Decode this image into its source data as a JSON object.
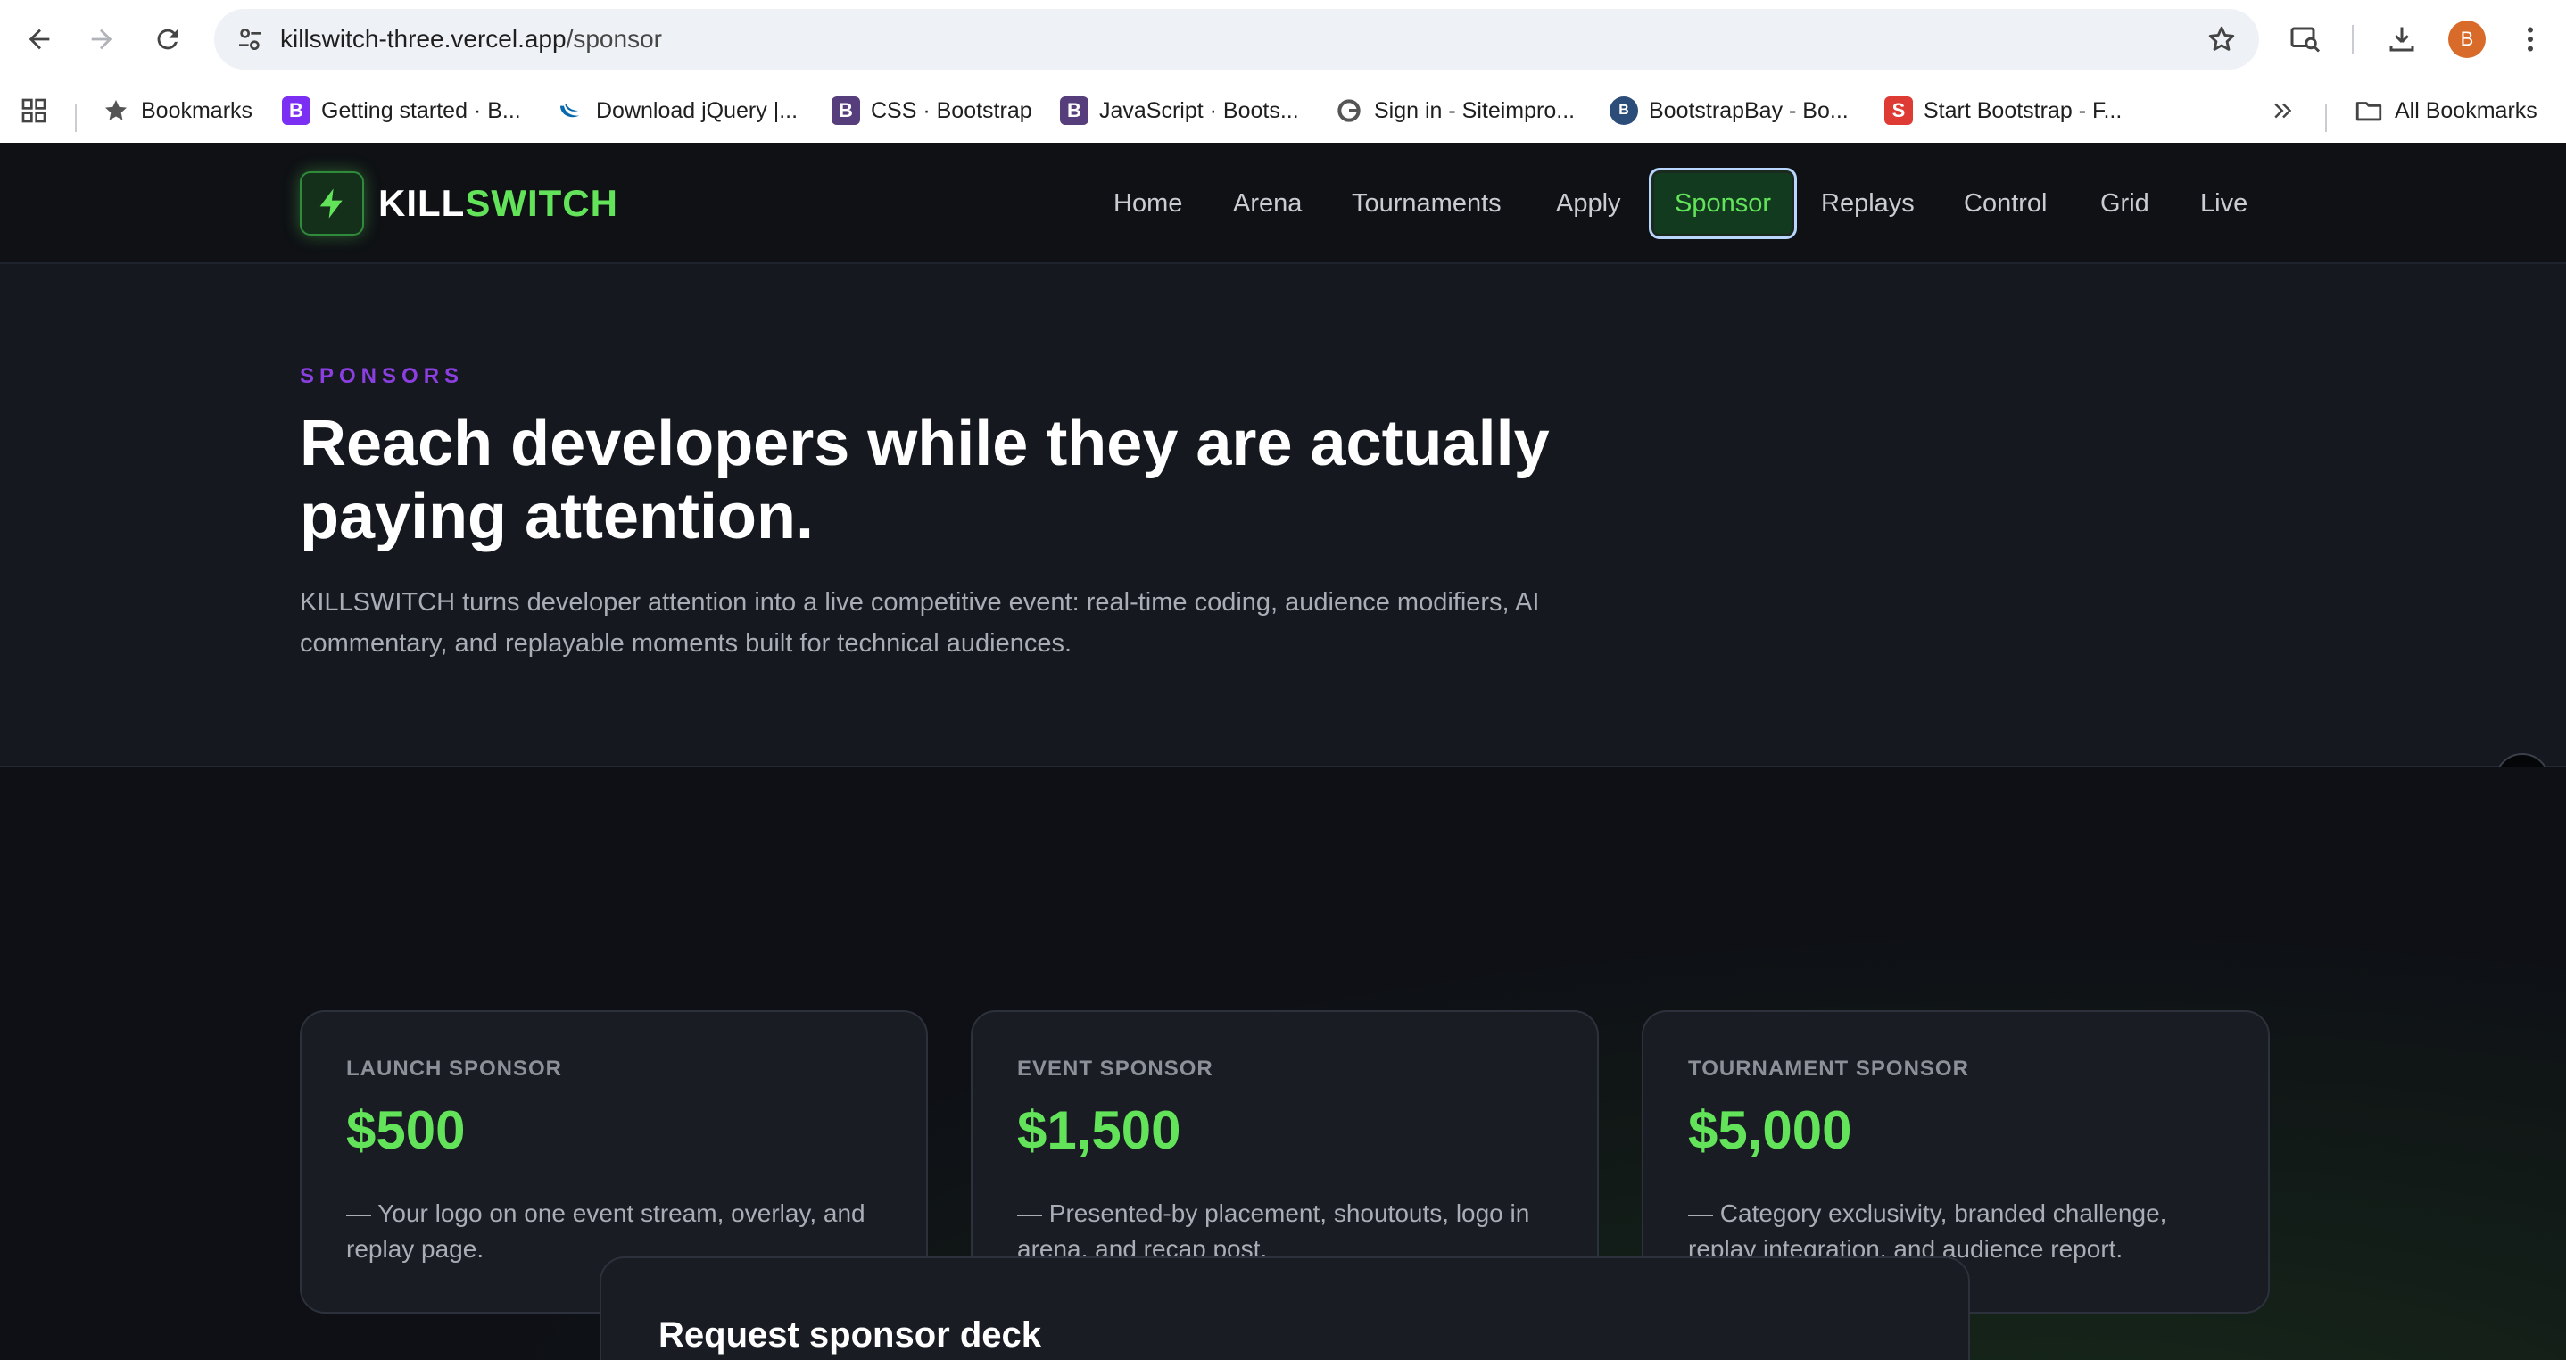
{
  "browser": {
    "url_host": "killswitch-three.vercel.app",
    "url_path": "/sponsor",
    "avatar_letter": "B",
    "bookmarks": [
      {
        "label": "Bookmarks",
        "icon": "star-icon"
      },
      {
        "label": "Getting started · B...",
        "icon": "bootstrap-icon",
        "color": "#7b2ff2"
      },
      {
        "label": "Download jQuery |...",
        "icon": "jquery-icon"
      },
      {
        "label": "CSS · Bootstrap",
        "icon": "bootstrap-icon",
        "color": "#563d7c"
      },
      {
        "label": "JavaScript · Boots...",
        "icon": "bootstrap-icon",
        "color": "#563d7c"
      },
      {
        "label": "Sign in - Siteimpro...",
        "icon": "siteimprove-icon"
      },
      {
        "label": "BootstrapBay - Bo...",
        "icon": "bootstrapbay-icon",
        "color": "#2c4d7a"
      },
      {
        "label": "Start Bootstrap - F...",
        "icon": "startbootstrap-icon",
        "color": "#dd3b33"
      }
    ],
    "all_bookmarks": "All Bookmarks"
  },
  "site": {
    "logo_kill": "KILL",
    "logo_switch": "SWITCH",
    "nav": [
      "Home",
      "Arena",
      "Tournaments",
      "Apply",
      "Sponsor",
      "Replays",
      "Control",
      "Grid",
      "Live"
    ],
    "active_nav": "Sponsor"
  },
  "hero": {
    "eyebrow": "SPONSORS",
    "title": "Reach developers while they are actually paying attention.",
    "description": "KILLSWITCH turns developer attention into a live competitive event: real-time coding, audience modifiers, AI commentary, and replayable moments built for technical audiences."
  },
  "tiers": [
    {
      "label": "LAUNCH SPONSOR",
      "price": "$500",
      "desc": "— Your logo on one event stream, overlay, and replay page."
    },
    {
      "label": "EVENT SPONSOR",
      "price": "$1,500",
      "desc": "— Presented-by placement, shoutouts, logo in arena, and recap post."
    },
    {
      "label": "TOURNAMENT SPONSOR",
      "price": "$5,000",
      "desc": "— Category exclusivity, branded challenge, replay integration, and audience report."
    }
  ],
  "deck": {
    "title": "Request sponsor deck"
  },
  "colors": {
    "accent_green": "#63e35a",
    "eyebrow_purple": "#8b3fe0",
    "background": "#0e1015"
  }
}
